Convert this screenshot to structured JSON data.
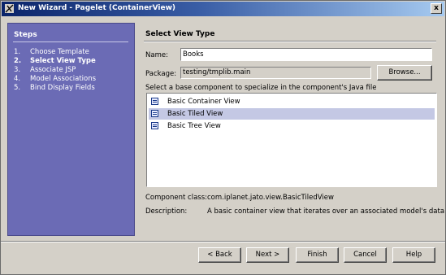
{
  "window": {
    "title": "New Wizard - Pagelet (ContainerView)",
    "close_label": "x"
  },
  "steps": {
    "title": "Steps",
    "items": [
      {
        "num": "1.",
        "label": "Choose Template"
      },
      {
        "num": "2.",
        "label": "Select View Type"
      },
      {
        "num": "3.",
        "label": "Associate JSP"
      },
      {
        "num": "4.",
        "label": "Model Associations"
      },
      {
        "num": "5.",
        "label": "Bind Display Fields"
      }
    ]
  },
  "main": {
    "title": "Select View Type",
    "name_label": "Name:",
    "name_value": "Books",
    "package_label": "Package:",
    "package_value": "testing/tmplib.main",
    "browse_label": "Browse...",
    "list_prompt": "Select a base component to specialize in the component's Java file",
    "list_items": [
      {
        "label": "Basic Container View"
      },
      {
        "label": "Basic Tiled View"
      },
      {
        "label": "Basic Tree View"
      }
    ],
    "selected_index": 1,
    "component_class_label": "Component class:",
    "component_class_value": "com.iplanet.jato.view.BasicTiledView",
    "description_label": "Description:",
    "description_value": "A basic container view that iterates over an associated model's data"
  },
  "buttons": {
    "back": "< Back",
    "next": "Next >",
    "finish": "Finish",
    "cancel": "Cancel",
    "help": "Help"
  },
  "colors": {
    "steps_panel": "#6b6bb5",
    "title_gradient_start": "#0a246a",
    "selection": "#c4c8e4"
  }
}
